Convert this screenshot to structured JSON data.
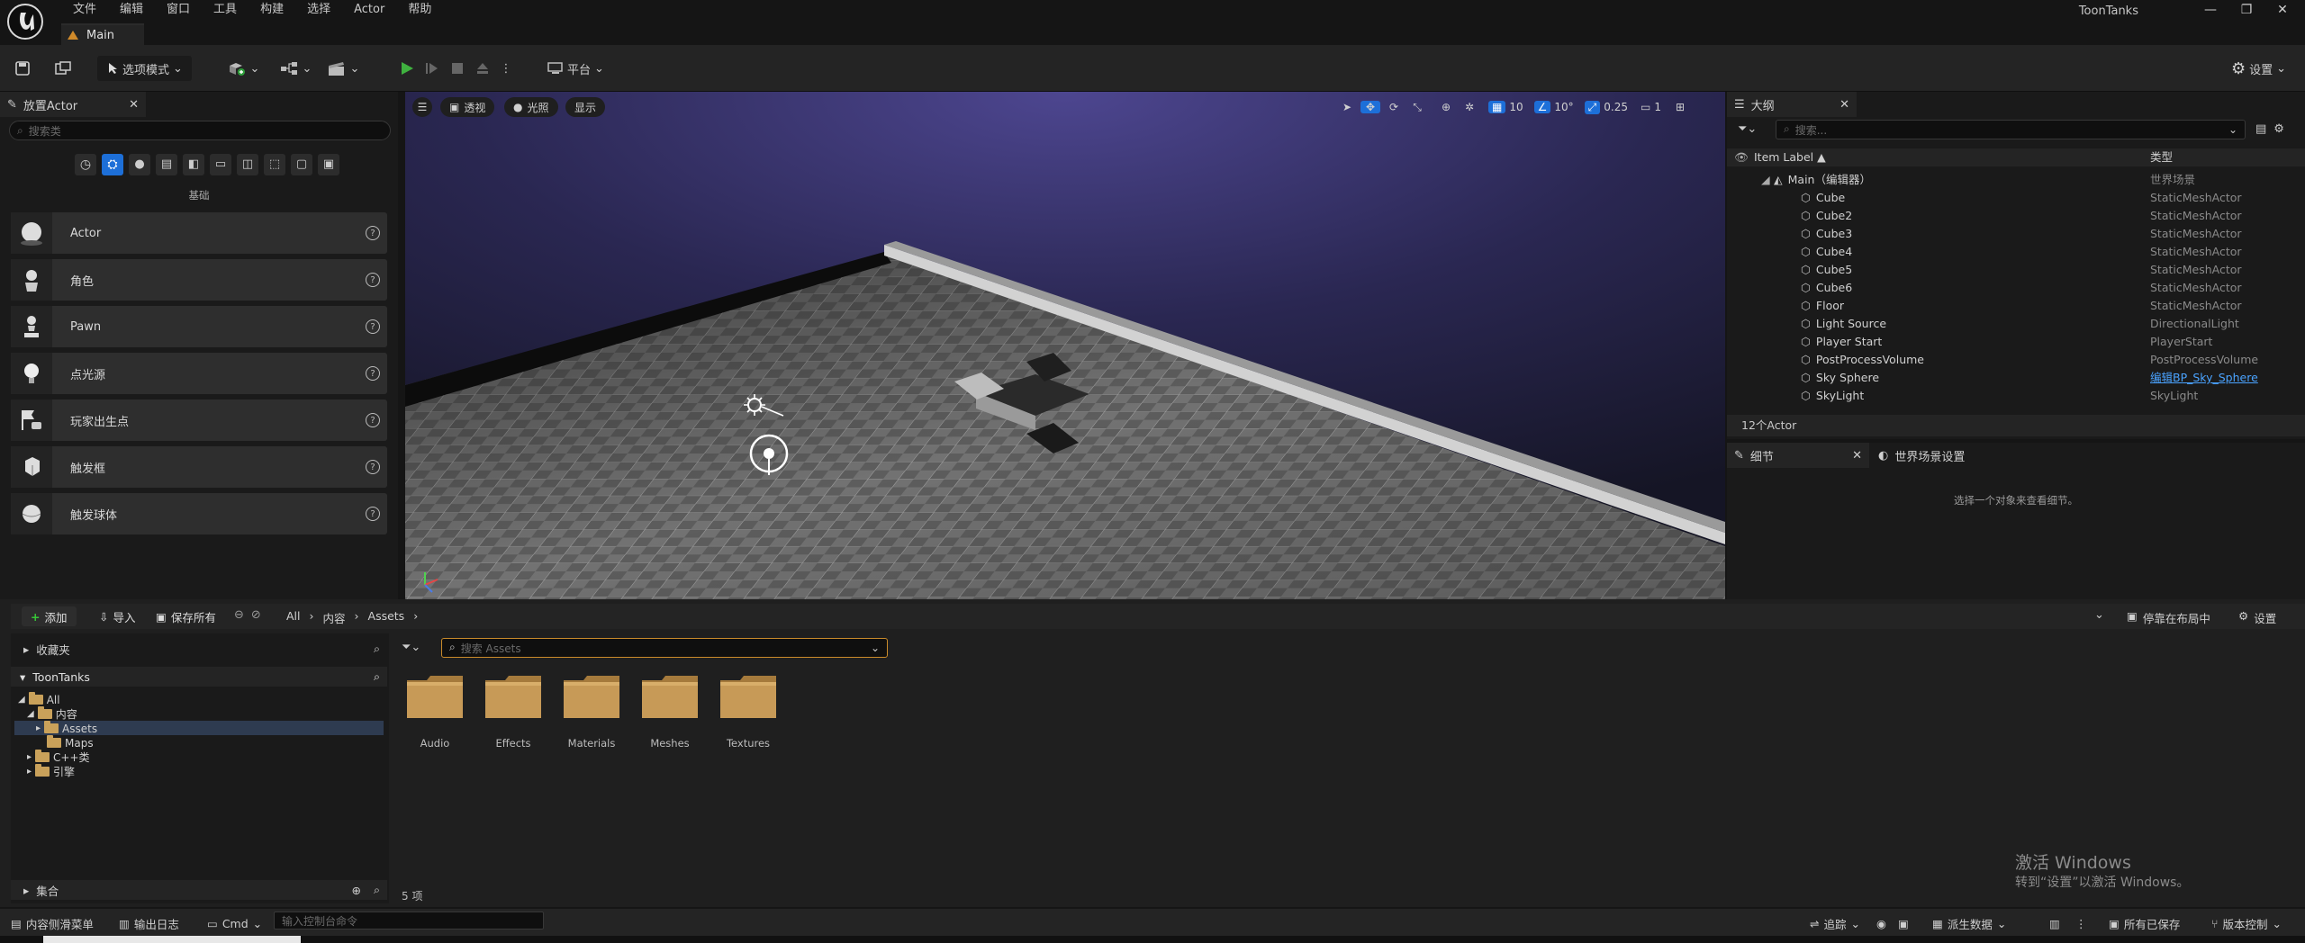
{
  "menu": [
    "文件",
    "编辑",
    "窗口",
    "工具",
    "构建",
    "选择",
    "Actor",
    "帮助"
  ],
  "window": {
    "title": "ToonTanks",
    "doc_tab": "Main"
  },
  "toolbar": {
    "mode": "选项模式",
    "platform": "平台",
    "settings": "设置"
  },
  "place_actor": {
    "tab": "放置Actor",
    "search_placeholder": "搜索类",
    "category": "基础",
    "items": [
      {
        "label": "Actor",
        "icon": "sphere-icon"
      },
      {
        "label": "角色",
        "icon": "character-icon"
      },
      {
        "label": "Pawn",
        "icon": "pawn-icon"
      },
      {
        "label": "点光源",
        "icon": "point-light-icon"
      },
      {
        "label": "玩家出生点",
        "icon": "player-start-icon"
      },
      {
        "label": "触发框",
        "icon": "trigger-box-icon"
      },
      {
        "label": "触发球体",
        "icon": "trigger-sphere-icon"
      }
    ]
  },
  "viewport": {
    "perspective": "透视",
    "lighting": "光照",
    "show": "显示",
    "grid_snap": "10",
    "rotation_snap": "10°",
    "scale_snap": "0.25",
    "camera_speed": "1"
  },
  "outliner": {
    "tab": "大纲",
    "search_placeholder": "搜索...",
    "col_label": "Item Label",
    "col_type": "类型",
    "root": {
      "name": "Main（编辑器）",
      "type": "世界场景"
    },
    "rows": [
      {
        "name": "Cube",
        "type": "StaticMeshActor"
      },
      {
        "name": "Cube2",
        "type": "StaticMeshActor"
      },
      {
        "name": "Cube3",
        "type": "StaticMeshActor"
      },
      {
        "name": "Cube4",
        "type": "StaticMeshActor"
      },
      {
        "name": "Cube5",
        "type": "StaticMeshActor"
      },
      {
        "name": "Cube6",
        "type": "StaticMeshActor"
      },
      {
        "name": "Floor",
        "type": "StaticMeshActor"
      },
      {
        "name": "Light Source",
        "type": "DirectionalLight"
      },
      {
        "name": "Player Start",
        "type": "PlayerStart"
      },
      {
        "name": "PostProcessVolume",
        "type": "PostProcessVolume"
      },
      {
        "name": "Sky Sphere",
        "type": "编辑BP_Sky_Sphere"
      },
      {
        "name": "SkyLight",
        "type": "SkyLight"
      }
    ],
    "count": "12个Actor"
  },
  "details": {
    "tab": "细节",
    "world_settings_tab": "世界场景设置",
    "empty_msg": "选择一个对象来查看细节。"
  },
  "content_browser": {
    "add": "添加",
    "import": "导入",
    "save_all": "保存所有",
    "path": [
      "All",
      "内容",
      "Assets"
    ],
    "dock": "停靠在布局中",
    "settings": "设置",
    "favorites": "收藏夹",
    "project": "ToonTanks",
    "collections": "集合",
    "search_placeholder": "搜索 Assets",
    "tree": [
      "All",
      "内容",
      "Assets",
      "Maps",
      "C++类",
      "引擎"
    ],
    "folders": [
      "Audio",
      "Effects",
      "Materials",
      "Meshes",
      "Textures"
    ],
    "count": "5 项"
  },
  "status": {
    "drawer": "内容侧滑菜单",
    "output_log": "输出日志",
    "cmd": "Cmd",
    "console_placeholder": "输入控制台命令",
    "trace": "追踪",
    "derived": "派生数据",
    "saved": "所有已保存",
    "source_control": "版本控制"
  },
  "watermark": {
    "line1": "激活 Windows",
    "line2": "转到“设置”以激活 Windows。"
  }
}
